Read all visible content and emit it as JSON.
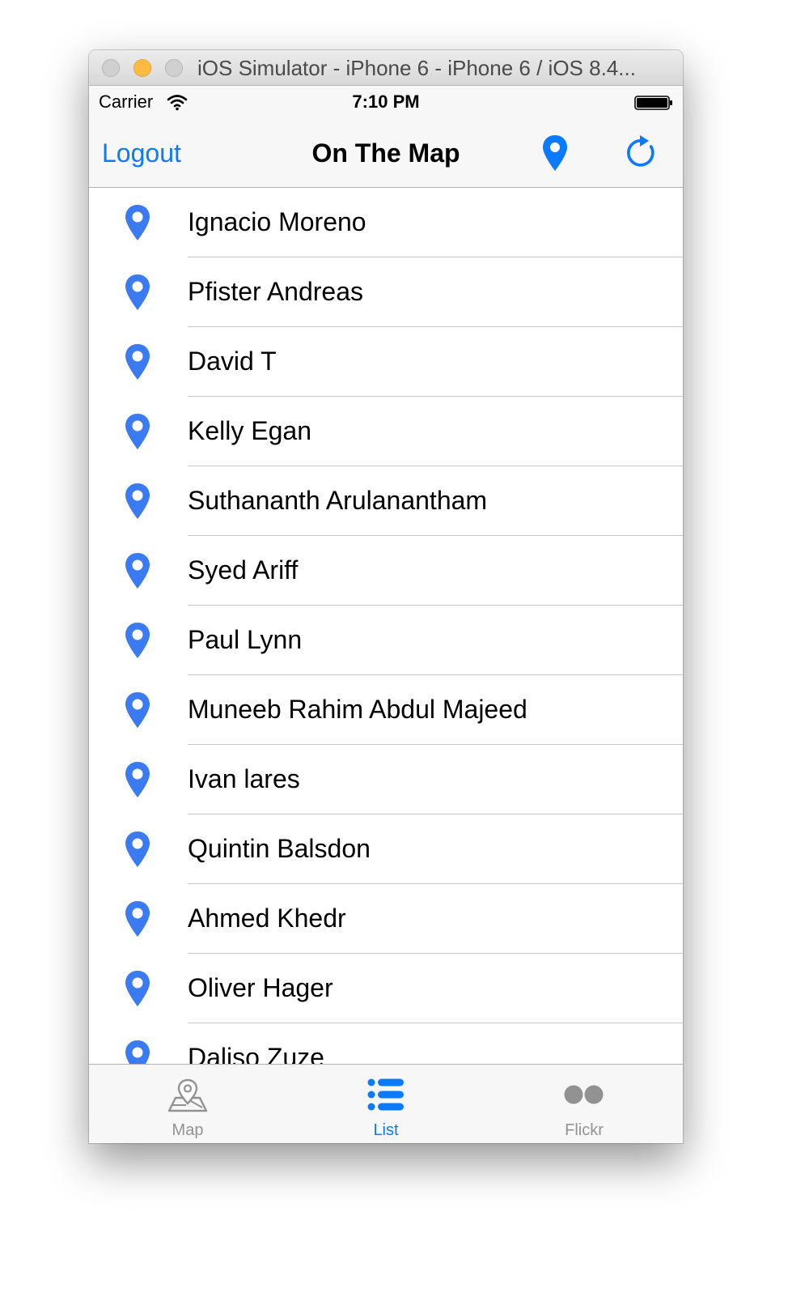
{
  "window": {
    "title": "iOS Simulator - iPhone 6 - iPhone 6 / iOS 8.4..."
  },
  "statusbar": {
    "carrier": "Carrier",
    "time": "7:10 PM"
  },
  "navbar": {
    "logout_label": "Logout",
    "title": "On The Map",
    "right_icons": [
      "pin-icon",
      "refresh-icon"
    ]
  },
  "students": [
    {
      "name": "Ignacio Moreno"
    },
    {
      "name": "Pfister Andreas"
    },
    {
      "name": "David T"
    },
    {
      "name": "Kelly Egan"
    },
    {
      "name": "Suthananth Arulanantham"
    },
    {
      "name": "Syed Ariff"
    },
    {
      "name": "Paul Lynn"
    },
    {
      "name": "Muneeb Rahim Abdul Majeed"
    },
    {
      "name": "Ivan lares"
    },
    {
      "name": "Quintin Balsdon"
    },
    {
      "name": "Ahmed Khedr"
    },
    {
      "name": "Oliver Hager"
    },
    {
      "name": "Daliso Zuze"
    }
  ],
  "tabbar": {
    "tabs": [
      {
        "label": "Map",
        "icon": "map-icon",
        "active": false
      },
      {
        "label": "List",
        "icon": "list-icon",
        "active": true
      },
      {
        "label": "Flickr",
        "icon": "flickr-icon",
        "active": false
      }
    ]
  },
  "colors": {
    "accent": "#0a7aff",
    "pin": "#3a7bf2",
    "inactive": "#929292"
  }
}
